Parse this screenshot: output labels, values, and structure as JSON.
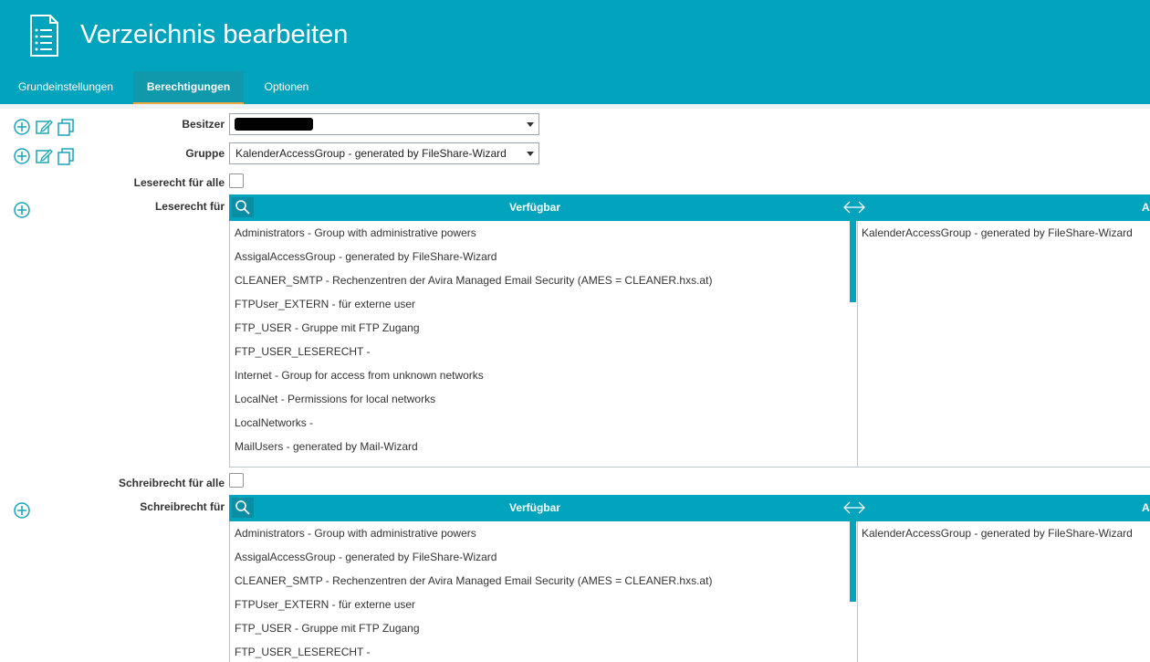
{
  "header": {
    "title": "Verzeichnis bearbeiten",
    "icon": "document-list-icon"
  },
  "tabs": [
    {
      "label": "Grundeinstellungen"
    },
    {
      "label": "Berechtigungen",
      "active": true
    },
    {
      "label": "Optionen"
    }
  ],
  "form": {
    "owner_label": "Besitzer",
    "owner_value": "",
    "group_label": "Gruppe",
    "group_value": "KalenderAccessGroup - generated by FileShare-Wizard",
    "read_all_label": "Leserecht für alle",
    "read_for_label": "Leserecht für",
    "write_all_label": "Schreibrecht für alle",
    "write_for_label": "Schreibrecht für"
  },
  "read_list": {
    "available_header": "Verfügbar",
    "available": [
      "Administrators - Group with administrative powers",
      "AssigalAccessGroup - generated by FileShare-Wizard",
      "CLEANER_SMTP - Rechenzentren der Avira Managed Email Security (AMES = CLEANER.hxs.at)",
      "FTPUser_EXTERN - für externe user",
      "FTP_USER - Gruppe mit FTP Zugang",
      "FTP_USER_LESERECHT -",
      "Internet - Group for access from unknown networks",
      "LocalNet - Permissions for local networks",
      "LocalNetworks -",
      "MailUsers - generated by Mail-Wizard"
    ],
    "assigned_header": "A",
    "assigned": [
      "KalenderAccessGroup - generated by FileShare-Wizard"
    ]
  },
  "write_list": {
    "available_header": "Verfügbar",
    "available": [
      "Administrators - Group with administrative powers",
      "AssigalAccessGroup - generated by FileShare-Wizard",
      "CLEANER_SMTP - Rechenzentren der Avira Managed Email Security (AMES = CLEANER.hxs.at)",
      "FTPUser_EXTERN - für externe user",
      "FTP_USER - Gruppe mit FTP Zugang",
      "FTP_USER_LESERECHT -"
    ],
    "assigned_header": "A",
    "assigned": [
      "KalenderAccessGroup - generated by FileShare-Wizard"
    ]
  },
  "colors": {
    "accent": "#01a4bc",
    "tab_underline": "#e7a83e",
    "icon": "#1aa4b8"
  }
}
